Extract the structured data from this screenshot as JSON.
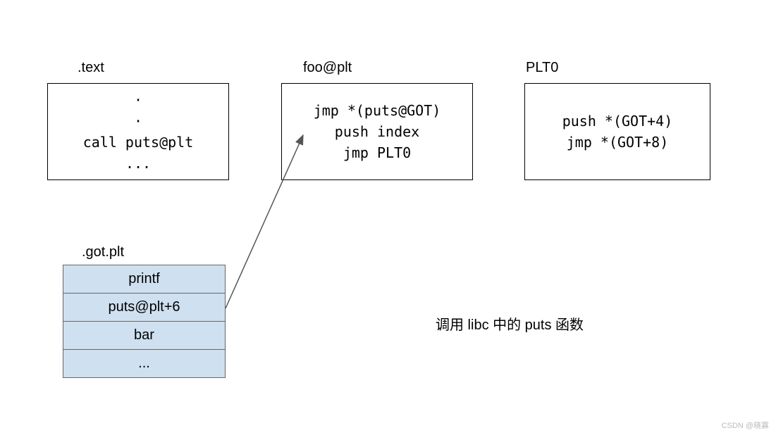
{
  "text_section": {
    "label": ".text",
    "lines": [
      "·",
      "·",
      "call puts@plt",
      "..."
    ]
  },
  "plt_entry": {
    "label": "foo@plt",
    "lines": [
      "jmp *(puts@GOT)",
      "push index",
      "jmp PLT0"
    ]
  },
  "plt0": {
    "label": "PLT0",
    "lines": [
      "push *(GOT+4)",
      "jmp *(GOT+8)"
    ]
  },
  "got_plt": {
    "label": ".got.plt",
    "rows": [
      "printf",
      "puts@plt+6",
      "bar",
      "..."
    ]
  },
  "caption": "调用 libc 中的 puts 函数",
  "watermark": "CSDN @晓寡"
}
